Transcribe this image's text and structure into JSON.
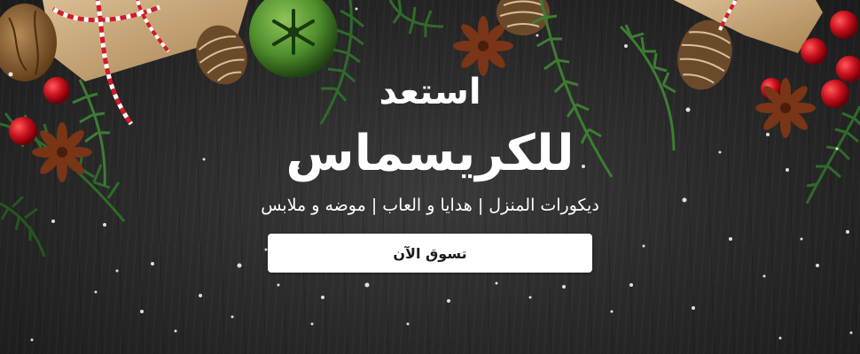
{
  "banner": {
    "headline_line1": "استعد",
    "headline_line2": "للكريسماس",
    "subtitle": "ديكورات المنزل | هدايا و العاب | موضه و ملابس",
    "cta_label": "تسوق الآن"
  },
  "colors": {
    "background": "#2b2b2b",
    "text": "#ffffff",
    "button_background": "#ffffff",
    "button_text": "#1d1d1d",
    "berry_red": "#c8101c",
    "pine_green": "#2f6b2a",
    "bell_green": "#4f8f2c",
    "gift_kraft": "#c9a87a"
  },
  "decorations": {
    "icons": [
      "gift-box-icon",
      "walnut-icon",
      "pine-cone-icon",
      "jingle-bell-icon",
      "star-anise-icon",
      "red-berries-icon",
      "pine-branch-icon",
      "snow-flake-icon"
    ]
  }
}
